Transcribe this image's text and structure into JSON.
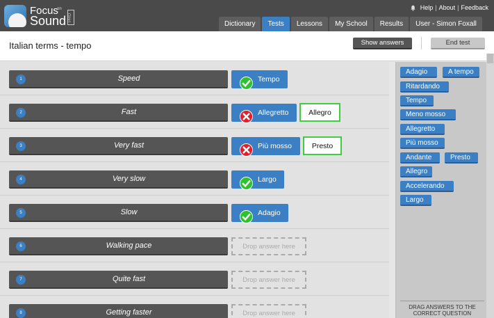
{
  "app": {
    "logo_line1": "Focus",
    "logo_on": "on",
    "logo_line2": "Sound",
    "logo_pro": "PRO"
  },
  "toplinks": {
    "help": "Help",
    "about": "About",
    "feedback": "Feedback"
  },
  "nav": {
    "tabs": [
      {
        "label": "Dictionary",
        "active": false
      },
      {
        "label": "Tests",
        "active": true
      },
      {
        "label": "Lessons",
        "active": false
      },
      {
        "label": "My School",
        "active": false
      },
      {
        "label": "Results",
        "active": false
      },
      {
        "label": "User - Simon Foxall",
        "active": false
      }
    ]
  },
  "page": {
    "title": "Italian terms - tempo",
    "show_answers": "Show answers",
    "end_test": "End test"
  },
  "questions": [
    {
      "num": "1",
      "text": "Speed",
      "answer": "Tempo",
      "result": "correct",
      "correct_answer": ""
    },
    {
      "num": "2",
      "text": "Fast",
      "answer": "Allegretto",
      "result": "wrong",
      "correct_answer": "Allegro"
    },
    {
      "num": "3",
      "text": "Very fast",
      "answer": "Più mosso",
      "result": "wrong",
      "correct_answer": "Presto"
    },
    {
      "num": "4",
      "text": "Very slow",
      "answer": "Largo",
      "result": "correct",
      "correct_answer": ""
    },
    {
      "num": "5",
      "text": "Slow",
      "answer": "Adagio",
      "result": "correct",
      "correct_answer": ""
    },
    {
      "num": "6",
      "text": "Walking pace",
      "answer": "",
      "result": "empty",
      "correct_answer": ""
    },
    {
      "num": "7",
      "text": "Quite fast",
      "answer": "",
      "result": "empty",
      "correct_answer": ""
    },
    {
      "num": "8",
      "text": "Getting faster",
      "answer": "",
      "result": "empty",
      "correct_answer": ""
    }
  ],
  "drop_placeholder": "Drop answer here",
  "bank": {
    "chips": [
      "Adagio",
      "A tempo",
      "Ritardando",
      "Tempo",
      "Meno mosso",
      "Allegretto",
      "Più mosso",
      "Andante",
      "Presto",
      "Allegro",
      "Accelerando",
      "Largo"
    ],
    "footer": "DRAG ANSWERS TO THE CORRECT QUESTION"
  },
  "colors": {
    "accent": "#3b7fc4",
    "header": "#4a4a4a",
    "correct": "#2fc12f",
    "wrong": "#e0202a",
    "correct_border": "#3ecf3e"
  }
}
